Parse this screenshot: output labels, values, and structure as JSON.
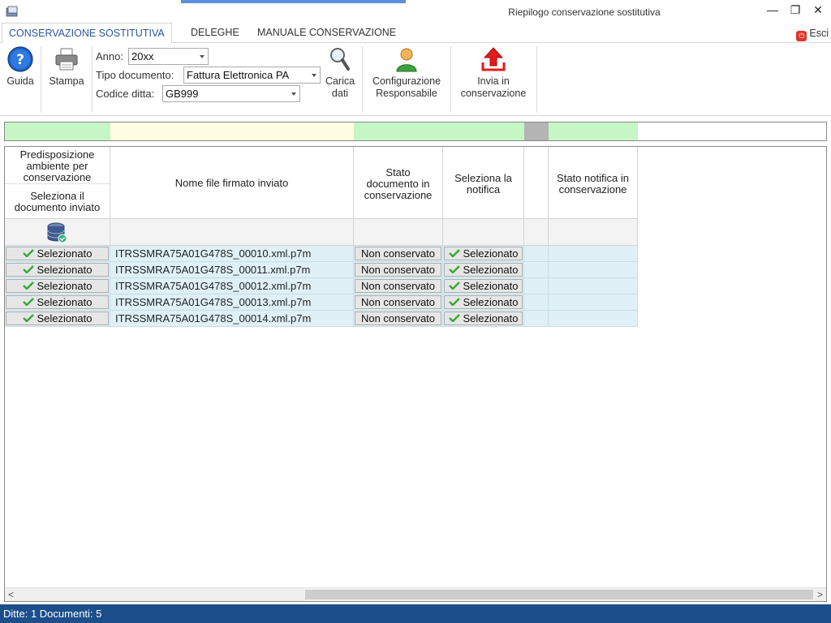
{
  "window": {
    "title": "Riepilogo conservazione sostitutiva",
    "minimize": "—",
    "restore": "❐",
    "close": "✕"
  },
  "tabs": [
    {
      "label": "CONSERVAZIONE SOSTITUTIVA",
      "active": true
    },
    {
      "label": "DELEGHE",
      "active": false
    },
    {
      "label": "MANUALE CONSERVAZIONE",
      "active": false
    }
  ],
  "exit_label": "Esci",
  "ribbon": {
    "guida": "Guida",
    "stampa": "Stampa",
    "anno_label": "Anno:",
    "anno_value": "20xx",
    "tipo_label": "Tipo documento:",
    "tipo_value": "Fattura Elettronica PA",
    "codice_label": "Codice ditta:",
    "codice_value": "GB999",
    "carica_line1": "Carica",
    "carica_line2": "dati",
    "config_line1": "Configurazione",
    "config_line2": "Responsabile",
    "invia_line1": "Invia in",
    "invia_line2": "conservazione"
  },
  "colors": {
    "green": "#c6f5c6",
    "yellow": "#fffde1",
    "gray": "#b4b4b4",
    "row_bg": "#dff0f7",
    "status_bar": "#1c4e8c",
    "accent": "#2b579a"
  },
  "grid": {
    "headers": {
      "col1_top": [
        "Predisposizione",
        "ambiente per",
        "conservazione"
      ],
      "col1_bottom": [
        "Seleziona il",
        "documento inviato"
      ],
      "col2": "Nome file firmato inviato",
      "col3": [
        "Stato",
        "documento in",
        "conservazione"
      ],
      "col4": [
        "Seleziona la",
        "notifica"
      ],
      "col6": [
        "Stato notifica in",
        "conservazione"
      ]
    },
    "rows": [
      {
        "selected": "Selezionato",
        "file": "ITRSSMRA75A01G478S_00010.xml.p7m",
        "stato": "Non conservato",
        "notifica": "Selezionato"
      },
      {
        "selected": "Selezionato",
        "file": "ITRSSMRA75A01G478S_00011.xml.p7m",
        "stato": "Non conservato",
        "notifica": "Selezionato"
      },
      {
        "selected": "Selezionato",
        "file": "ITRSSMRA75A01G478S_00012.xml.p7m",
        "stato": "Non conservato",
        "notifica": "Selezionato"
      },
      {
        "selected": "Selezionato",
        "file": "ITRSSMRA75A01G478S_00013.xml.p7m",
        "stato": "Non conservato",
        "notifica": "Selezionato"
      },
      {
        "selected": "Selezionato",
        "file": "ITRSSMRA75A01G478S_00014.xml.p7m",
        "stato": "Non conservato",
        "notifica": "Selezionato"
      }
    ]
  },
  "status": "Ditte: 1 Documenti: 5"
}
